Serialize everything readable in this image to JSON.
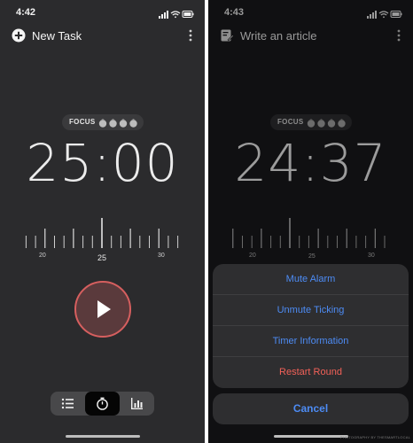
{
  "left": {
    "status": {
      "time": "4:42"
    },
    "header": {
      "title": "New Task",
      "leading_icon": "plus-circle-icon",
      "menu_icon": "more-vertical-icon"
    },
    "focus": {
      "label": "FOCUS",
      "icon": "tomato-icon",
      "count": 4
    },
    "timer": {
      "display": "25:00"
    },
    "ruler": {
      "labels": [
        "20",
        "25",
        "30"
      ]
    },
    "play": {
      "icon": "play-icon"
    },
    "tabs": [
      {
        "icon": "list-icon",
        "active": false
      },
      {
        "icon": "stopwatch-icon",
        "active": true
      },
      {
        "icon": "bar-chart-icon",
        "active": false
      }
    ]
  },
  "right": {
    "status": {
      "time": "4:43"
    },
    "header": {
      "title": "Write an article",
      "leading_icon": "edit-note-icon",
      "menu_icon": "more-vertical-icon"
    },
    "focus": {
      "label": "FOCUS",
      "icon": "tomato-icon",
      "count": 4
    },
    "timer": {
      "display": "24:37"
    },
    "ruler": {
      "labels": [
        "20",
        "25",
        "30"
      ]
    },
    "action_sheet": {
      "items": [
        {
          "label": "Mute Alarm",
          "destructive": false
        },
        {
          "label": "Unmute Ticking",
          "destructive": false
        },
        {
          "label": "Timer Information",
          "destructive": false
        },
        {
          "label": "Restart Round",
          "destructive": true
        }
      ],
      "cancel_label": "Cancel"
    },
    "watermark": "PHOTOGRAPHY BY THESMARTLOCAL"
  },
  "colors": {
    "accent": "#4d8cf5",
    "destructive": "#f26158",
    "play_ring": "#d65f5f",
    "left_background": "#2b2b2d",
    "right_background": "#101012"
  }
}
